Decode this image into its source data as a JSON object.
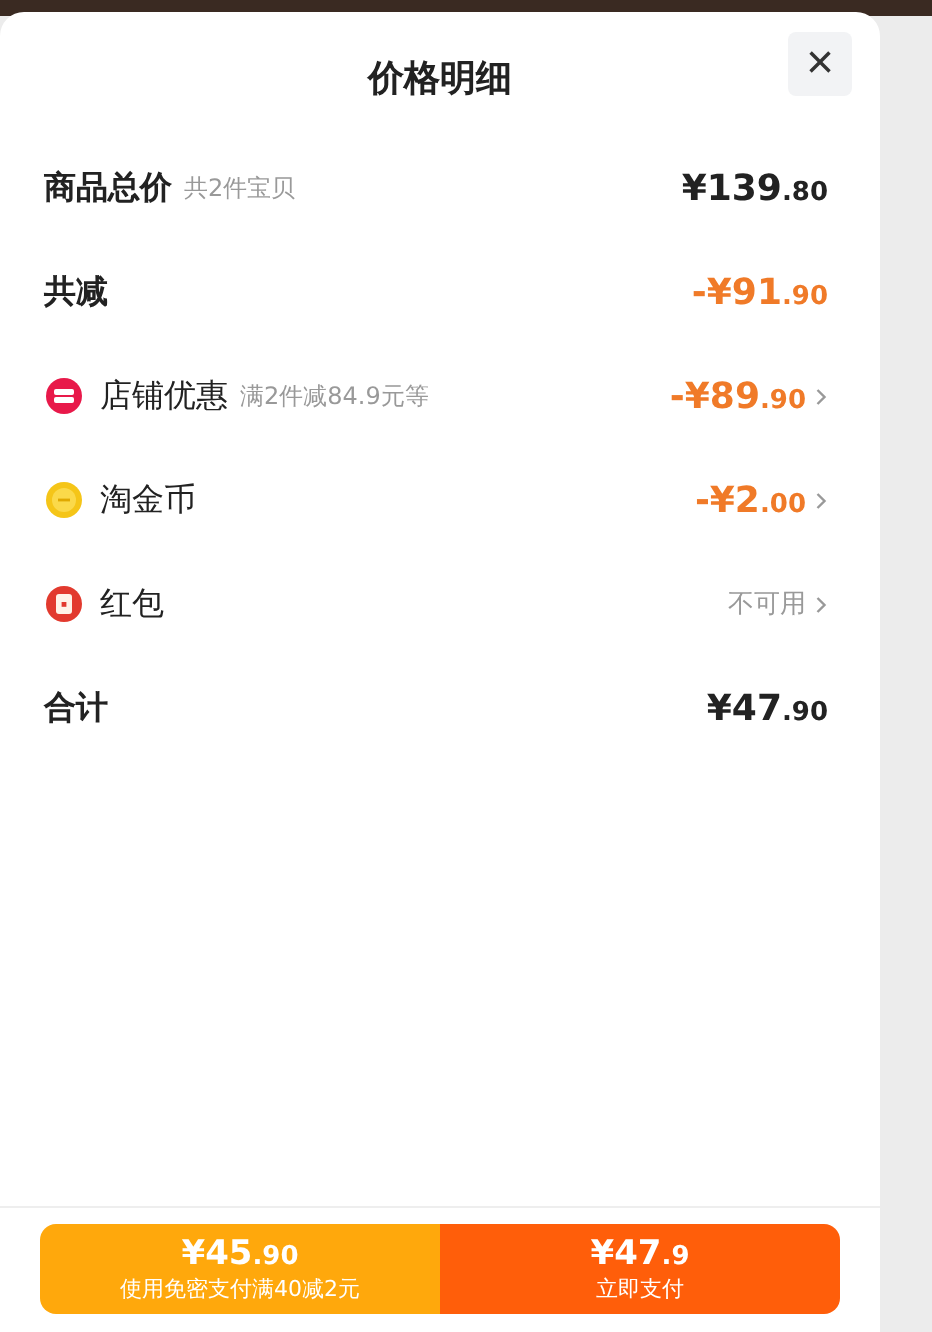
{
  "sheet": {
    "title": "价格明细",
    "close_label": "×"
  },
  "rows": [
    {
      "kind": "plain",
      "label": "商品总价",
      "note": "共2件宝贝",
      "discount": false,
      "amount": {
        "integer": "¥139",
        "decimal": ".80"
      },
      "expandable": false
    },
    {
      "kind": "plain",
      "label": "共减",
      "discount": true,
      "amount": {
        "integer": "-¥91",
        "decimal": ".90"
      },
      "expandable": false
    },
    {
      "kind": "store",
      "label": "店铺优惠",
      "note": "满2件减84.9元等",
      "discount": true,
      "amount": {
        "integer": "-¥89",
        "decimal": ".90"
      },
      "expandable": true
    },
    {
      "kind": "coin",
      "label": "淘金币",
      "discount": true,
      "amount": {
        "integer": "-¥2",
        "decimal": ".00"
      },
      "expandable": true
    },
    {
      "kind": "redpacket",
      "label": "红包",
      "status": "不可用",
      "expandable": true
    },
    {
      "kind": "plain",
      "label": "合计",
      "discount": false,
      "amount": {
        "integer": "¥47",
        "decimal": ".90"
      },
      "expandable": false
    }
  ],
  "footer": {
    "buttons": [
      {
        "kind": "secondary",
        "amount": {
          "integer": "¥45",
          "decimal": ".90"
        },
        "caption": "使用免密支付满40减2元"
      },
      {
        "kind": "primary",
        "amount": {
          "integer": "¥47",
          "decimal": ".9"
        },
        "caption": "立即支付"
      }
    ]
  }
}
